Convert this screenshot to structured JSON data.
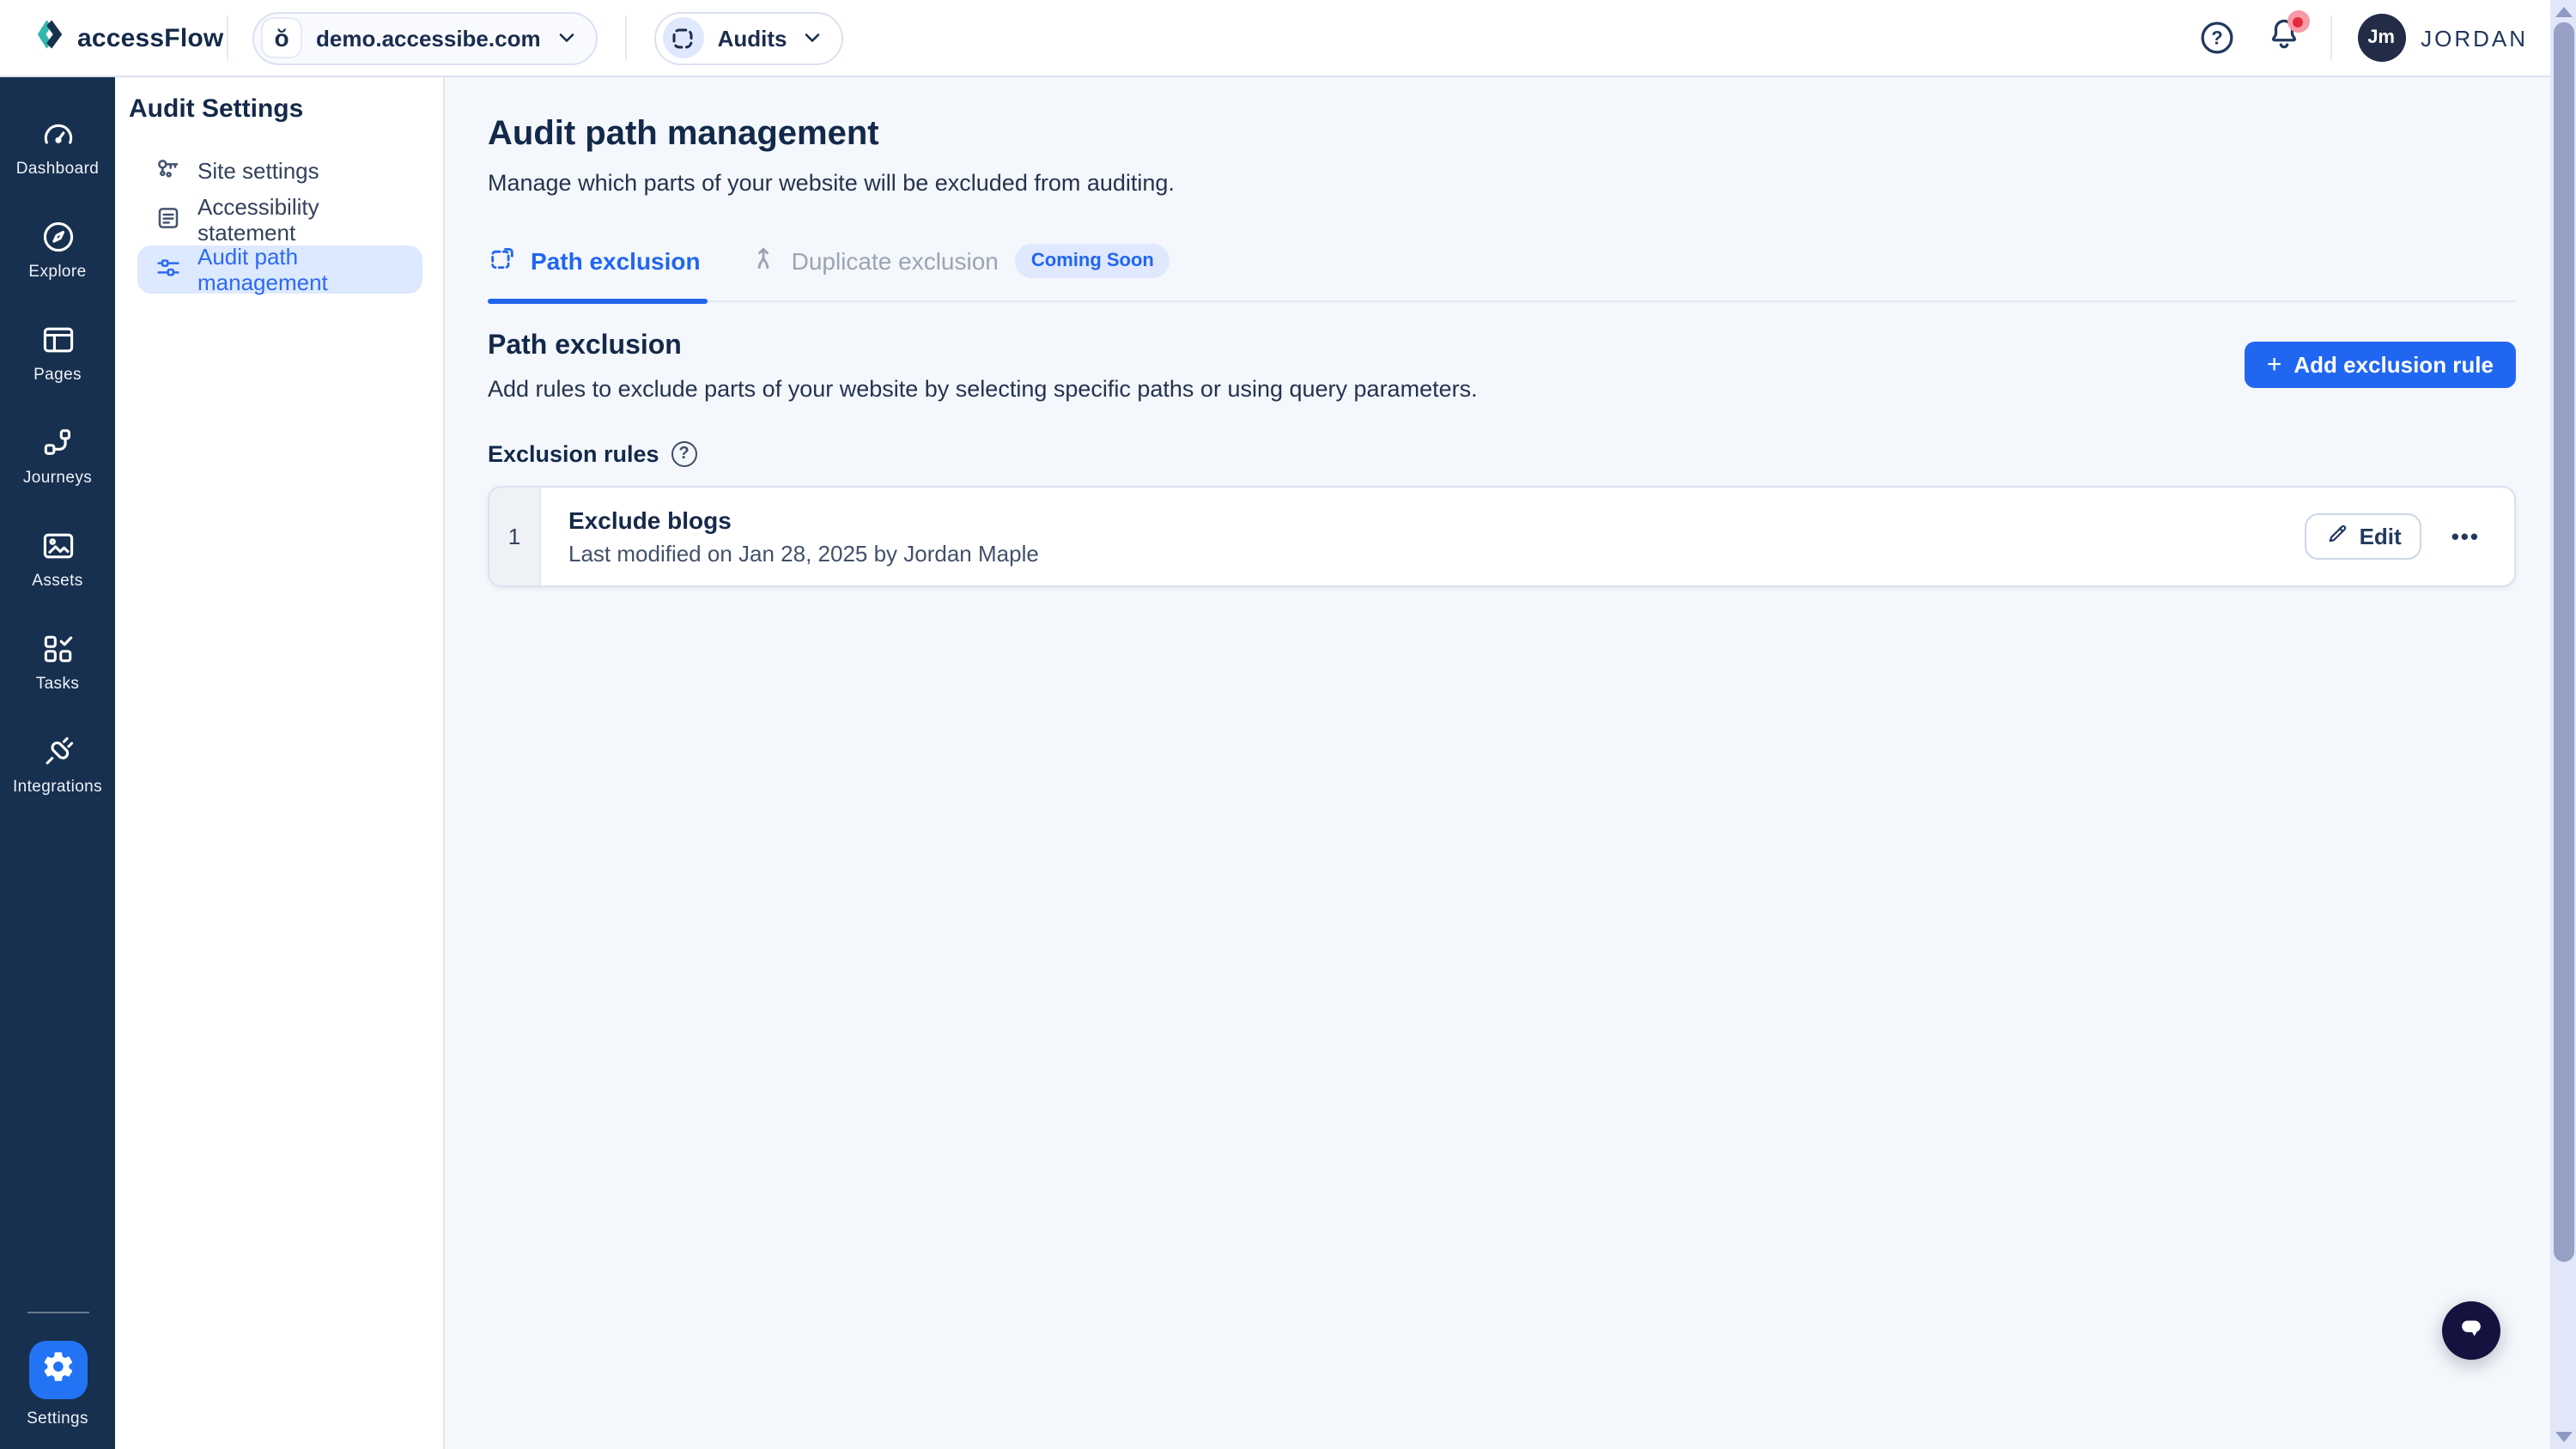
{
  "header": {
    "brand": "accessFlow",
    "site_selector": {
      "favicon_glyph": "ŏ",
      "value": "demo.accessibe.com"
    },
    "context_selector": {
      "value": "Audits"
    },
    "help_glyph": "?",
    "user": {
      "initials": "Jm",
      "name": "JORDAN"
    }
  },
  "sidebar": {
    "items": [
      {
        "label": "Dashboard"
      },
      {
        "label": "Explore"
      },
      {
        "label": "Pages"
      },
      {
        "label": "Journeys"
      },
      {
        "label": "Assets"
      },
      {
        "label": "Tasks"
      },
      {
        "label": "Integrations"
      }
    ],
    "settings_label": "Settings"
  },
  "subnav": {
    "title": "Audit Settings",
    "items": [
      {
        "label": "Site settings"
      },
      {
        "label": "Accessibility statement"
      },
      {
        "label": "Audit path management"
      }
    ],
    "active_index": 2
  },
  "main": {
    "title": "Audit path management",
    "subtitle": "Manage which parts of your website will be excluded from auditing.",
    "tabs": [
      {
        "label": "Path exclusion",
        "active": true
      },
      {
        "label": "Duplicate exclusion",
        "badge": "Coming Soon"
      }
    ],
    "section": {
      "title": "Path exclusion",
      "description": "Add rules to exclude parts of your website by selecting specific paths or using query parameters.",
      "plus_glyph": "+",
      "add_button_label": "Add exclusion rule"
    },
    "rules_header": "Exclusion rules",
    "rules_info_glyph": "?",
    "rules": [
      {
        "index": "1",
        "title": "Exclude blogs",
        "meta": "Last modified on Jan 28, 2025 by Jordan Maple",
        "edit_label": "Edit",
        "more_glyph": "•••"
      }
    ]
  },
  "colors": {
    "accent_blue": "#2066f1",
    "sidebar_navy": "#18304f",
    "teal_logo": "#35b5b0",
    "badge_bg": "#dfe8fc",
    "selected_item_bg": "#dde9fe",
    "main_bg": "#f4f7fb",
    "chat_navy": "#14123f",
    "notification_red": "#e62a3c",
    "scroll_thumb": "#96a1c5"
  }
}
